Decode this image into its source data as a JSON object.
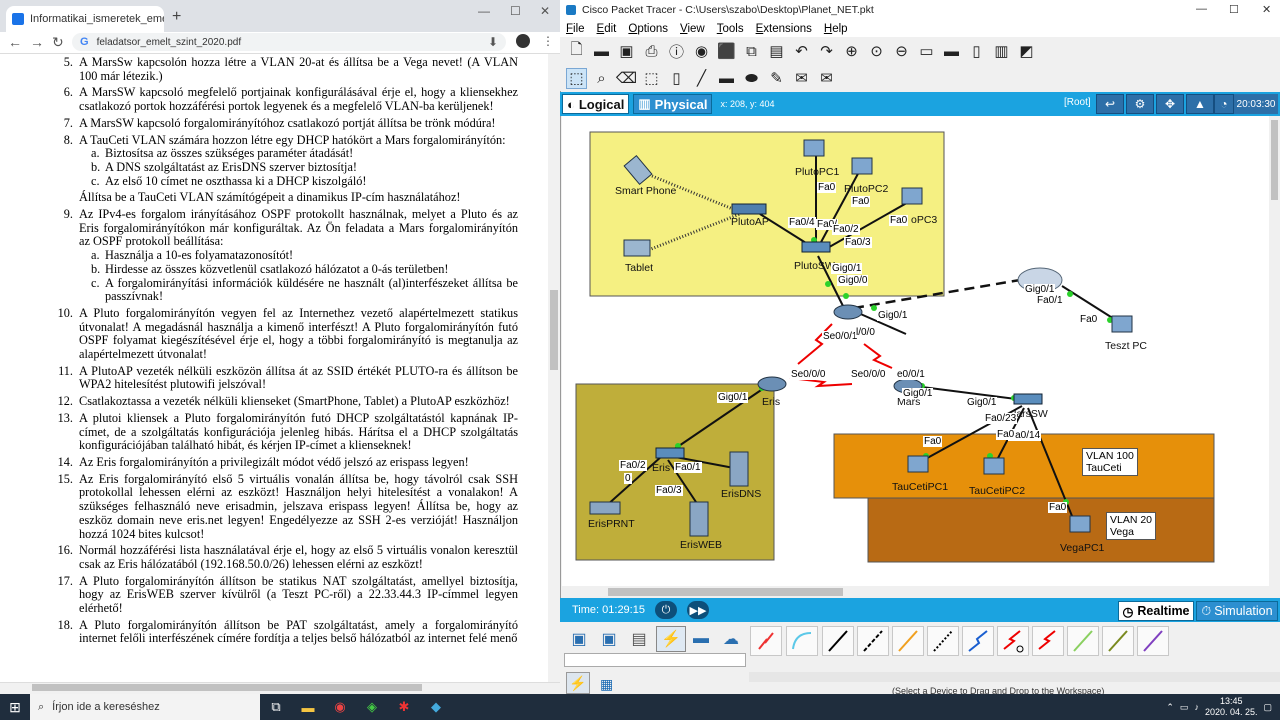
{
  "chrome": {
    "tab_title": "Informatikai_ismeretek_emelt_sz",
    "tab_close": "×",
    "new_tab": "+",
    "address": "feladatsor_emelt_szint_2020.pdf",
    "window_controls": [
      "—",
      "☐",
      "✕"
    ]
  },
  "pdf_items": [
    {
      "num": "5.",
      "text": "A MarsSw kapcsolón hozza létre a VLAN 20-at és állítsa be a Vega nevet! (A VLAN 100 már létezik.)"
    },
    {
      "num": "6.",
      "text": "A MarsSW kapcsoló megfelelő portjainak konfigurálásával érje el, hogy a kliensekhez csatlakozó portok hozzáférési portok legyenek és a megfelelő VLAN-ba kerüljenek!"
    },
    {
      "num": "7.",
      "text": "A MarsSW kapcsoló forgalomirányítóhoz csatlakozó portját állítsa be trönk módúra!"
    },
    {
      "num": "8.",
      "text": "A TauCeti VLAN számára hozzon létre egy DHCP hatókört a Mars forgalomirányítón:",
      "subs": [
        {
          "l": "a.",
          "t": "Biztosítsa az összes szükséges paraméter átadását!"
        },
        {
          "l": "b.",
          "t": "A DNS szolgáltatást az ErisDNS szerver biztosítja!"
        },
        {
          "l": "c.",
          "t": "Az első 10 címet ne oszthassa ki a DHCP kiszolgáló!"
        }
      ],
      "after": "Állítsa be a TauCeti VLAN számítógépeit a dinamikus IP-cím használatához!"
    },
    {
      "num": "9.",
      "text": "Az IPv4-es forgalom irányításához OSPF protokollt használnak, melyet a Pluto és az Eris forgalomirányítókon már konfiguráltak. Az Ön feladata a Mars forgalomirányítón az OSPF protokoll beállítása:",
      "subs": [
        {
          "l": "a.",
          "t": "Használja a 10-es folyamatazonosítót!"
        },
        {
          "l": "b.",
          "t": "Hirdesse az összes közvetlenül csatlakozó hálózatot a 0-ás területben!"
        },
        {
          "l": "c.",
          "t": "A forgalomirányítási információk küldésére ne használt (al)interfészeket állítsa be passzívnak!"
        }
      ]
    },
    {
      "num": "10.",
      "text": "A Pluto forgalomirányítón vegyen fel az Internethez vezető alapértelmezett statikus útvonalat! A megadásnál használja a kimenő interfészt! A Pluto forgalomirányítón futó OSPF folyamat kiegészítésével érje el, hogy a többi forgalomirányító is megtanulja az alapértelmezett útvonalat!"
    },
    {
      "num": "11.",
      "text": "A PlutoAP vezeték nélküli eszközön állítsa át az SSID értékét PLUTO-ra és állítson be WPA2 hitelesítést plutowifi jelszóval!"
    },
    {
      "num": "12.",
      "text": "Csatlakoztassa a vezeték nélküli klienseket (SmartPhone, Tablet) a PlutoAP eszközhöz!"
    },
    {
      "num": "13.",
      "text": "A plutoi kliensek a Pluto forgalomirányítón futó DHCP szolgáltatástól kapnának IP-címet, de a szolgáltatás konfigurációja jelenleg hibás. Hárítsa el a DHCP szolgáltatás konfigurációjában található hibát, és kérjen IP-címet a klienseknek!"
    },
    {
      "num": "14.",
      "text": "Az Eris forgalomirányítón a privilegizált módot védő jelszó az erispass legyen!"
    },
    {
      "num": "15.",
      "text": "Az Eris forgalomirányító első 5 virtuális vonalán állítsa be, hogy távolról csak SSH protokollal lehessen elérni az eszközt! Használjon helyi hitelesítést a vonalakon! A szükséges felhasználó neve erisadmin, jelszava erispass legyen! Állítsa be, hogy az eszköz domain neve eris.net legyen! Engedélyezze az SSH 2-es verzióját! Használjon hozzá 1024 bites kulcsot!"
    },
    {
      "num": "16.",
      "text": "Normál hozzáférési lista használatával érje el, hogy az első 5 virtuális vonalon keresztül csak az Eris hálózatából (192.168.50.0/26) lehessen elérni az eszközt!"
    },
    {
      "num": "17.",
      "text": "A Pluto forgalomirányítón állítson be statikus NAT szolgáltatást, amellyel biztosítja, hogy az ErisWEB szerver kívülről (a Teszt PC-ről) a 22.33.44.3 IP-címmel legyen elérhető!"
    },
    {
      "num": "18.",
      "text": "A Pluto forgalomirányítón állítson be PAT szolgáltatást, amely a forgalomirányító internet felőli interfészének címére fordítja a teljes belső hálózatból az internet felé menő"
    }
  ],
  "pt": {
    "title": "Cisco Packet Tracer - C:\\Users\\szabo\\Desktop\\Planet_NET.pkt",
    "window_controls": [
      "—",
      "☐",
      "✕"
    ],
    "menu": [
      "File",
      "Edit",
      "Options",
      "View",
      "Tools",
      "Extensions",
      "Help"
    ],
    "logical": "Logical",
    "physical": "Physical",
    "coords": "x: 208, y: 404",
    "root": "[Root]",
    "clock": "20:03:30",
    "time": "Time: 01:29:15",
    "realtime": "Realtime",
    "simulation": "Simulation",
    "status_hint": "(Select a Device to Drag and Drop to the Workspace)"
  },
  "network": {
    "devices": {
      "smartphone": "Smart Phone",
      "tablet": "Tablet",
      "plutoap": "PlutoAP",
      "plutopc1": "PlutoPC1",
      "plutopc2": "PlutoPC2",
      "plutopc3": "oPC3",
      "plutosw": "PlutoSW",
      "pluto": "",
      "cloud": "",
      "tesztpc": "Teszt PC",
      "eris": "Eris",
      "mars": "Mars",
      "marssw": "larsSW",
      "erissw": "Eris",
      "erisdns": "ErisDNS",
      "erisweb": "ErisWEB",
      "erisprnt": "ErisPRNT",
      "taucetipc1": "TauCetiPC1",
      "taucetipc2": "TauCetiPC2",
      "vegapc1": "VegaPC1"
    },
    "ports": [
      "Fa0",
      "Fa0",
      "Fa0",
      "Fa0/4",
      "Fa0/",
      "Fa0/2",
      "Fa0/3",
      "Gig0/1",
      "Gig0/0",
      "Gig0/1",
      "Se0/0/1",
      "l/0/0",
      "Gig0/1",
      "Fa0/1",
      "Fa0",
      "Se0/0/0",
      "Se0/0/0",
      "e0/0/1",
      "Gig0/1",
      "Gig0/1",
      "Fa0/23",
      "Fa0/14",
      "Fa0",
      "Fa0",
      "Fa0",
      "Gig0/1",
      "Fa0/2",
      "0",
      "Fa0/1",
      "Fa0/3"
    ],
    "vlans": [
      {
        "name": "VLAN 100",
        "sub": "TauCeti"
      },
      {
        "name": "VLAN 20",
        "sub": "Vega"
      }
    ]
  },
  "taskbar": {
    "search": "Írjon ide a kereséshez",
    "time": "13:45",
    "date": "2020. 04. 25."
  }
}
